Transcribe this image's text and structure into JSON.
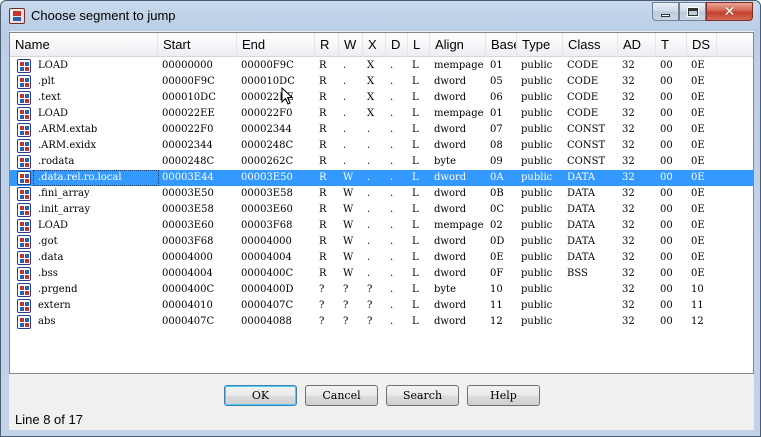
{
  "window": {
    "title": "Choose segment to jump"
  },
  "titlebar": {
    "min_glyph": "–",
    "max_glyph": "□",
    "close_glyph": "✕"
  },
  "columns": [
    "Name",
    "Start",
    "End",
    "R",
    "W",
    "X",
    "D",
    "L",
    "Align",
    "Base",
    "Type",
    "Class",
    "AD",
    "T",
    "DS"
  ],
  "rows": [
    [
      "LOAD",
      "00000000",
      "00000F9C",
      "R",
      ".",
      "X",
      ".",
      "L",
      "mempage",
      "01",
      "public",
      "CODE",
      "32",
      "00",
      "0E"
    ],
    [
      ".plt",
      "00000F9C",
      "000010DC",
      "R",
      ".",
      "X",
      ".",
      "L",
      "dword",
      "05",
      "public",
      "CODE",
      "32",
      "00",
      "0E"
    ],
    [
      ".text",
      "000010DC",
      "000022EE",
      "R",
      ".",
      "X",
      ".",
      "L",
      "dword",
      "06",
      "public",
      "CODE",
      "32",
      "00",
      "0E"
    ],
    [
      "LOAD",
      "000022EE",
      "000022F0",
      "R",
      ".",
      "X",
      ".",
      "L",
      "mempage",
      "01",
      "public",
      "CODE",
      "32",
      "00",
      "0E"
    ],
    [
      ".ARM.extab",
      "000022F0",
      "00002344",
      "R",
      ".",
      ".",
      ".",
      "L",
      "dword",
      "07",
      "public",
      "CONST",
      "32",
      "00",
      "0E"
    ],
    [
      ".ARM.exidx",
      "00002344",
      "0000248C",
      "R",
      ".",
      ".",
      ".",
      "L",
      "dword",
      "08",
      "public",
      "CONST",
      "32",
      "00",
      "0E"
    ],
    [
      ".rodata",
      "0000248C",
      "0000262C",
      "R",
      ".",
      ".",
      ".",
      "L",
      "byte",
      "09",
      "public",
      "CONST",
      "32",
      "00",
      "0E"
    ],
    [
      ".data.rel.ro.local",
      "00003E44",
      "00003E50",
      "R",
      "W",
      ".",
      ".",
      "L",
      "dword",
      "0A",
      "public",
      "DATA",
      "32",
      "00",
      "0E"
    ],
    [
      ".fini_array",
      "00003E50",
      "00003E58",
      "R",
      "W",
      ".",
      ".",
      "L",
      "dword",
      "0B",
      "public",
      "DATA",
      "32",
      "00",
      "0E"
    ],
    [
      ".init_array",
      "00003E58",
      "00003E60",
      "R",
      "W",
      ".",
      ".",
      "L",
      "dword",
      "0C",
      "public",
      "DATA",
      "32",
      "00",
      "0E"
    ],
    [
      "LOAD",
      "00003E60",
      "00003F68",
      "R",
      "W",
      ".",
      ".",
      "L",
      "mempage",
      "02",
      "public",
      "DATA",
      "32",
      "00",
      "0E"
    ],
    [
      ".got",
      "00003F68",
      "00004000",
      "R",
      "W",
      ".",
      ".",
      "L",
      "dword",
      "0D",
      "public",
      "DATA",
      "32",
      "00",
      "0E"
    ],
    [
      ".data",
      "00004000",
      "00004004",
      "R",
      "W",
      ".",
      ".",
      "L",
      "dword",
      "0E",
      "public",
      "DATA",
      "32",
      "00",
      "0E"
    ],
    [
      ".bss",
      "00004004",
      "0000400C",
      "R",
      "W",
      ".",
      ".",
      "L",
      "dword",
      "0F",
      "public",
      "BSS",
      "32",
      "00",
      "0E"
    ],
    [
      ".prgend",
      "0000400C",
      "0000400D",
      "?",
      "?",
      "?",
      ".",
      "L",
      "byte",
      "10",
      "public",
      "",
      "32",
      "00",
      "10"
    ],
    [
      "extern",
      "00004010",
      "0000407C",
      "?",
      "?",
      "?",
      ".",
      "L",
      "dword",
      "11",
      "public",
      "",
      "32",
      "00",
      "11"
    ],
    [
      "abs",
      "0000407C",
      "00004088",
      "?",
      "?",
      "?",
      ".",
      "L",
      "dword",
      "12",
      "public",
      "",
      "32",
      "00",
      "12"
    ]
  ],
  "selected_row": 7,
  "buttons": {
    "ok": "OK",
    "cancel": "Cancel",
    "search": "Search",
    "help": "Help"
  },
  "status": {
    "line": "Line 8 of 17"
  },
  "colors": {
    "selection": "#3399ff",
    "title_gradient": "#b9cde6",
    "close": "#c2402a"
  },
  "icons": {
    "app": "ida-app-icon",
    "segment": "segment-icon",
    "pointer": "mouse-pointer-icon"
  }
}
